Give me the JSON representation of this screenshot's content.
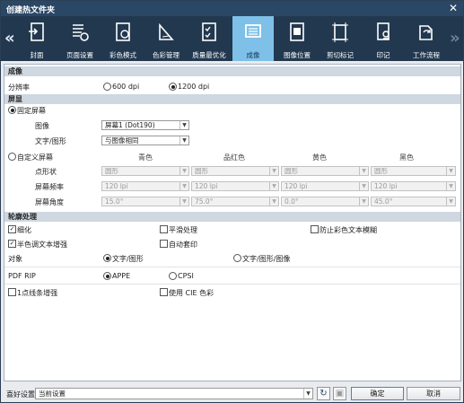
{
  "window": {
    "title": "创建热文件夹",
    "close": "✕"
  },
  "nav": {
    "left": "«",
    "right": "»"
  },
  "tabs": [
    {
      "label": "封面",
      "icon": "cover-icon"
    },
    {
      "label": "页面设置",
      "icon": "page-setup-icon"
    },
    {
      "label": "彩色模式",
      "icon": "color-mode-icon"
    },
    {
      "label": "色彩管理",
      "icon": "color-management-icon"
    },
    {
      "label": "质量最优化",
      "icon": "quality-optimization-icon"
    },
    {
      "label": "成像",
      "icon": "imaging-icon",
      "active": true
    },
    {
      "label": "图像位置",
      "icon": "image-position-icon"
    },
    {
      "label": "剪切标记",
      "icon": "crop-marks-icon"
    },
    {
      "label": "印记",
      "icon": "stamp-icon"
    },
    {
      "label": "工作流程",
      "icon": "workflow-icon"
    }
  ],
  "imaging": {
    "header": "成像",
    "resolution_label": "分辨率",
    "res_600": "600 dpi",
    "res_1200": "1200 dpi",
    "screen_header": "屏显",
    "fixed_screen": "固定屏幕",
    "image_label": "图像",
    "image_value": "屏幕1 (Dot190)",
    "text_label": "文字/图形",
    "text_value": "与图像相同",
    "custom_screen": "自定义屏幕",
    "cols": [
      "青色",
      "品红色",
      "黄色",
      "黑色"
    ],
    "rows": [
      {
        "label": "点形状",
        "values": [
          "圆形",
          "圆形",
          "圆形",
          "圆形"
        ]
      },
      {
        "label": "屏幕频率",
        "values": [
          "120 lpi",
          "120 lpi",
          "120 lpi",
          "120 lpi"
        ]
      },
      {
        "label": "屏幕角度",
        "values": [
          "15.0°",
          "75.0°",
          "0.0°",
          "45.0°"
        ]
      }
    ],
    "outline_header": "轮廓处理",
    "thinning": "细化",
    "smoothing": "平滑处理",
    "prevent_blur": "防止彩色文本模糊",
    "halftone_enhance": "半色调文本增强",
    "auto_trap": "自动套印",
    "target_label": "对象",
    "target_text": "文字/图形",
    "target_text_image": "文字/图形/图像",
    "pdfrip_label": "PDF RIP",
    "appe": "APPE",
    "cpsi": "CPSI",
    "line_enhance": "1点线条增强",
    "use_cie": "使用 CIE 色彩"
  },
  "footer": {
    "pref_label": "喜好设置",
    "pref_value": "当前设置",
    "ok": "确定",
    "cancel": "取消"
  }
}
